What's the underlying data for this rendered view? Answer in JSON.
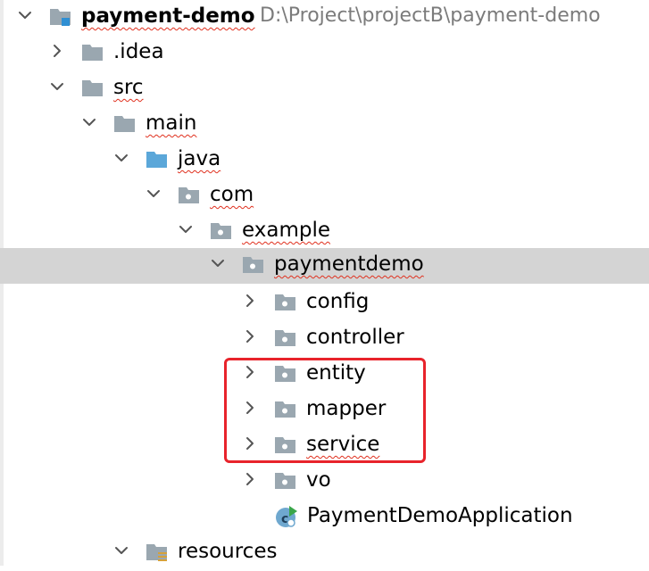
{
  "project_tree": {
    "root": {
      "name": "payment-demo",
      "path": "D:\\Project\\projectB\\payment-demo",
      "icon": "module-folder-icon"
    },
    "items": [
      {
        "label": ".idea",
        "icon": "folder-icon",
        "expanded": false
      },
      {
        "label": "src",
        "icon": "folder-icon",
        "expanded": true
      },
      {
        "label": "main",
        "icon": "folder-icon",
        "expanded": true
      },
      {
        "label": "java",
        "icon": "source-root-folder-icon",
        "expanded": true
      },
      {
        "label": "com",
        "icon": "package-icon",
        "expanded": true
      },
      {
        "label": "example",
        "icon": "package-icon",
        "expanded": true
      },
      {
        "label": "paymentdemo",
        "icon": "package-icon",
        "expanded": true,
        "selected": true
      },
      {
        "label": "config",
        "icon": "package-icon",
        "expanded": false
      },
      {
        "label": "controller",
        "icon": "package-icon",
        "expanded": false
      },
      {
        "label": "entity",
        "icon": "package-icon",
        "expanded": false
      },
      {
        "label": "mapper",
        "icon": "package-icon",
        "expanded": false
      },
      {
        "label": "service",
        "icon": "package-icon",
        "expanded": false
      },
      {
        "label": "vo",
        "icon": "package-icon",
        "expanded": false
      },
      {
        "label": "PaymentDemoApplication",
        "icon": "spring-boot-class-icon"
      },
      {
        "label": "resources",
        "icon": "resources-folder-icon",
        "expanded": true
      }
    ]
  },
  "colors": {
    "selected_row": "#d4d4d4",
    "highlight_box": "#e8232b",
    "folder_gray": "#9aa7b0",
    "source_root_blue": "#5ba7d9",
    "spelling_squiggle": "#e0301e",
    "path_text": "#7b7b7b"
  }
}
